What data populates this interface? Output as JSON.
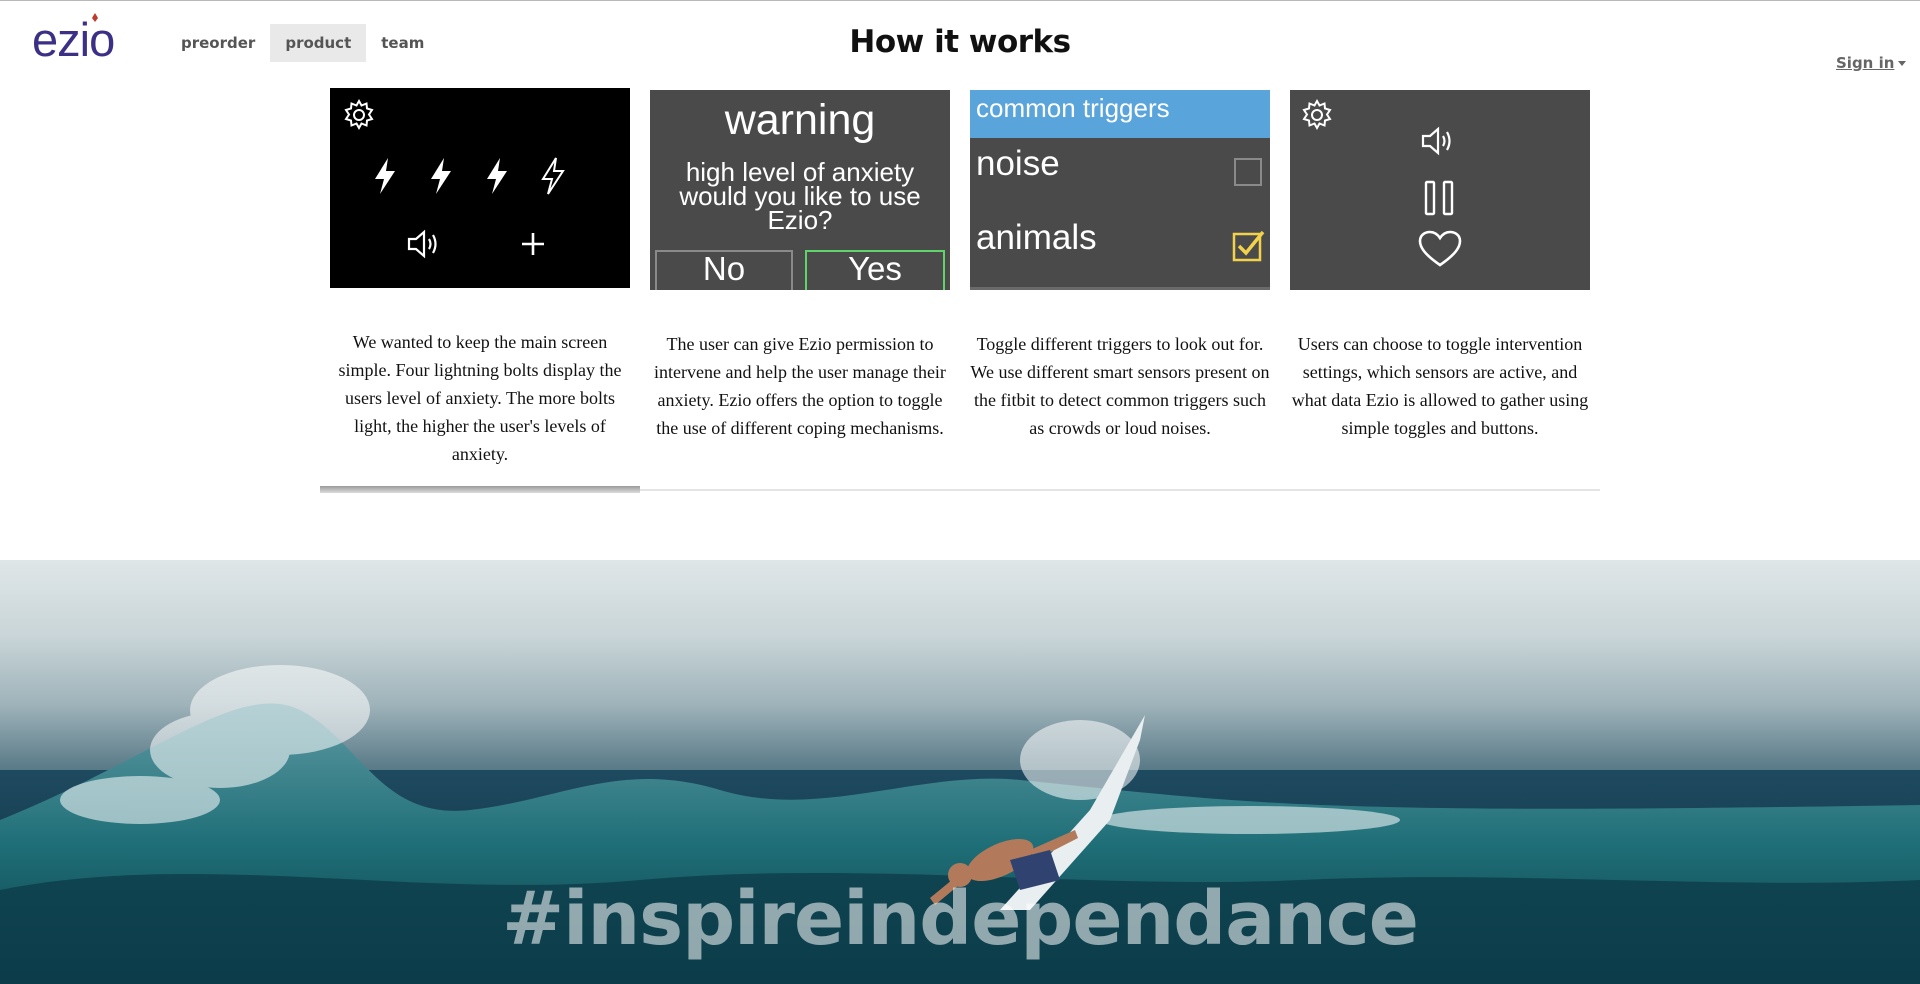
{
  "header": {
    "logo": "ezio",
    "nav": [
      "preorder",
      "product",
      "team"
    ],
    "active_nav": "product",
    "title": "How it works",
    "signin": "Sign in"
  },
  "cards": [
    {
      "screen": {
        "icons": [
          "gear-icon",
          "bolt-icon",
          "bolt-icon",
          "bolt-icon",
          "bolt-outline-icon",
          "speaker-icon",
          "plus-icon"
        ]
      },
      "description": "We wanted to keep the main screen simple. Four lightning bolts display the users level of anxiety. The more bolts light, the higher the user's levels of anxiety."
    },
    {
      "screen": {
        "title": "warning",
        "message_line1": "high level of anxiety",
        "message_line2": "would you like to use",
        "message_line3": "Ezio?",
        "no": "No",
        "yes": "Yes"
      },
      "description": "The user can give Ezio permission to intervene and help the user manage their anxiety. Ezio offers the option to toggle the use of different coping mechanisms."
    },
    {
      "screen": {
        "header": "common triggers",
        "items": [
          {
            "label": "noise",
            "checked": false
          },
          {
            "label": "animals",
            "checked": true
          }
        ]
      },
      "description": "Toggle different triggers to look out for. We use different smart sensors present on the fitbit to detect common triggers such as crowds or loud noises."
    },
    {
      "screen": {
        "icons": [
          "gear-icon",
          "speaker-icon",
          "pause-icon",
          "heart-icon"
        ]
      },
      "description": "Users can choose to toggle intervention settings, which sensors are active, and what data Ezio is allowed to gather using simple toggles and buttons."
    }
  ],
  "hero": {
    "hashtag": "#inspireindependance"
  },
  "colors": {
    "logo": "#3b2f86",
    "logo_accent": "#c0392b",
    "trigger_header": "#5aa4dc",
    "checkbox_checked": "#f2d24a",
    "yes_border": "#5fd46a"
  }
}
